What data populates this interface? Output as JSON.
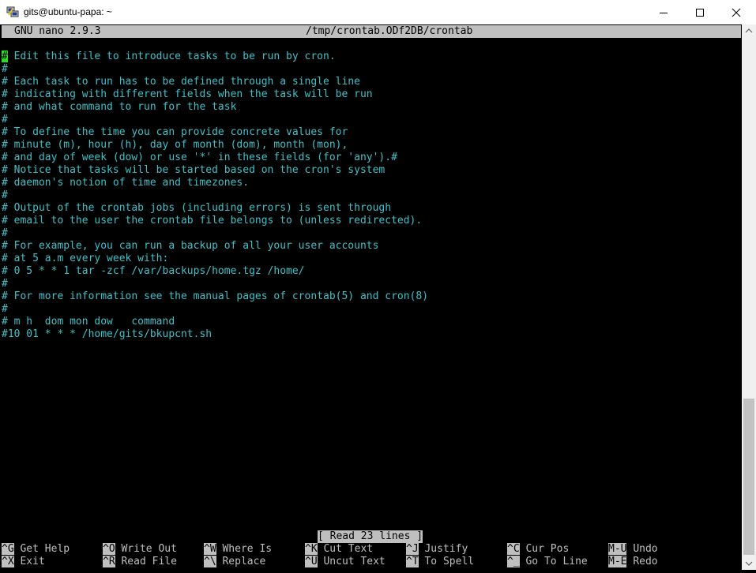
{
  "window": {
    "title": "gits@ubuntu-papa: ~",
    "icon": "putty-icon"
  },
  "nano": {
    "version": "GNU nano 2.9.3",
    "filename": "/tmp/crontab.ODf2DB/crontab",
    "cursor_char": "#",
    "first_line_rest": " Edit this file to introduce tasks to be run by cron.",
    "lines": [
      "#",
      "# Each task to run has to be defined through a single line",
      "# indicating with different fields when the task will be run",
      "# and what command to run for the task",
      "#",
      "# To define the time you can provide concrete values for",
      "# minute (m), hour (h), day of month (dom), month (mon),",
      "# and day of week (dow) or use '*' in these fields (for 'any').#",
      "# Notice that tasks will be started based on the cron's system",
      "# daemon's notion of time and timezones.",
      "#",
      "# Output of the crontab jobs (including errors) is sent through",
      "# email to the user the crontab file belongs to (unless redirected).",
      "#",
      "# For example, you can run a backup of all your user accounts",
      "# at 5 a.m every week with:",
      "# 0 5 * * 1 tar -zcf /var/backups/home.tgz /home/",
      "#",
      "# For more information see the manual pages of crontab(5) and cron(8)",
      "#",
      "# m h  dom mon dow   command",
      "#10 01 * * * /home/gits/bkupcnt.sh"
    ],
    "status": "[ Read 23 lines ]",
    "shortcuts_row1": [
      {
        "key": "^G",
        "label": "Get Help"
      },
      {
        "key": "^O",
        "label": "Write Out"
      },
      {
        "key": "^W",
        "label": "Where Is"
      },
      {
        "key": "^K",
        "label": "Cut Text"
      },
      {
        "key": "^J",
        "label": "Justify"
      },
      {
        "key": "^C",
        "label": "Cur Pos"
      },
      {
        "key": "M-U",
        "label": "Undo"
      }
    ],
    "shortcuts_row2": [
      {
        "key": "^X",
        "label": "Exit"
      },
      {
        "key": "^R",
        "label": "Read File"
      },
      {
        "key": "^\\",
        "label": "Replace"
      },
      {
        "key": "^U",
        "label": "Uncut Text"
      },
      {
        "key": "^T",
        "label": "To Spell"
      },
      {
        "key": "^_",
        "label": "Go To Line"
      },
      {
        "key": "M-E",
        "label": "Redo"
      }
    ]
  },
  "colors": {
    "text": "#3dc1c8",
    "background": "#000000",
    "bar": "#bfbfbf",
    "cursor": "#22e61b"
  }
}
